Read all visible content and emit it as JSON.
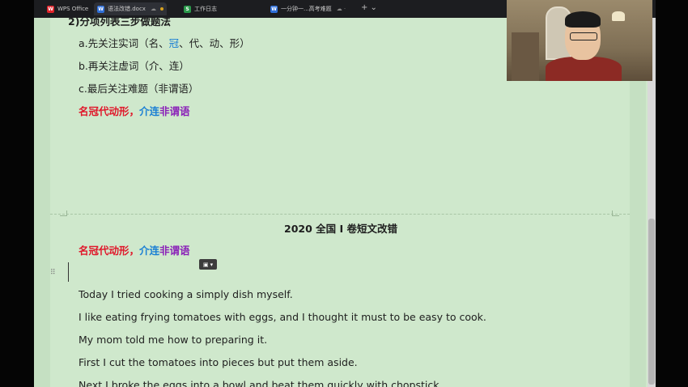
{
  "tabs": [
    {
      "label": "WPS Office",
      "icon": "wps-logo-icon",
      "color": "#e0232a",
      "icon_glyph": "W"
    },
    {
      "label": "语法改错.docx",
      "icon": "word-doc-icon",
      "color": "#2f6fd8",
      "icon_glyph": "W",
      "active": true
    },
    {
      "label": "工作日志",
      "icon": "sheet-icon",
      "color": "#2b9a4b",
      "icon_glyph": "S"
    },
    {
      "label": "一分钟一...高考难题",
      "icon": "word-doc-icon",
      "color": "#2f6fd8",
      "icon_glyph": "W"
    }
  ],
  "new_tab_label": "+ ⌄",
  "section1": {
    "heading": "2)分项列表三步做题法",
    "items": [
      {
        "prefix": "a.先关注实词（名、",
        "highlight": "冠",
        "suffix": "、代、动、形）"
      },
      {
        "text": "b.再关注虚词（介、连）"
      },
      {
        "text": "c.最后关注难题（非谓语）"
      }
    ],
    "mnemonic": {
      "red": "名冠代动形，",
      "blue": "介连",
      "purple": "非谓语"
    }
  },
  "section2": {
    "title": "2020 全国 I 卷短文改错",
    "mnemonic": {
      "red": "名冠代动形，",
      "blue": "介连",
      "purple": "非谓语"
    },
    "paragraphs": [
      "Today I tried cooking a simply dish myself.",
      "I like eating frying tomatoes with eggs, and I thought it must to be easy to cook.",
      "My mom told me how to preparing it.",
      "First I cut the tomatoes into pieces but put them aside.",
      "Next I broke the eggs into a bowl and beat them quickly with chopstick."
    ]
  },
  "colors": {
    "doc_background": "#cfe8cc",
    "mnemonic_red": "#e0172a",
    "mnemonic_blue": "#1a7fd4",
    "mnemonic_purple": "#8a1fb8"
  }
}
